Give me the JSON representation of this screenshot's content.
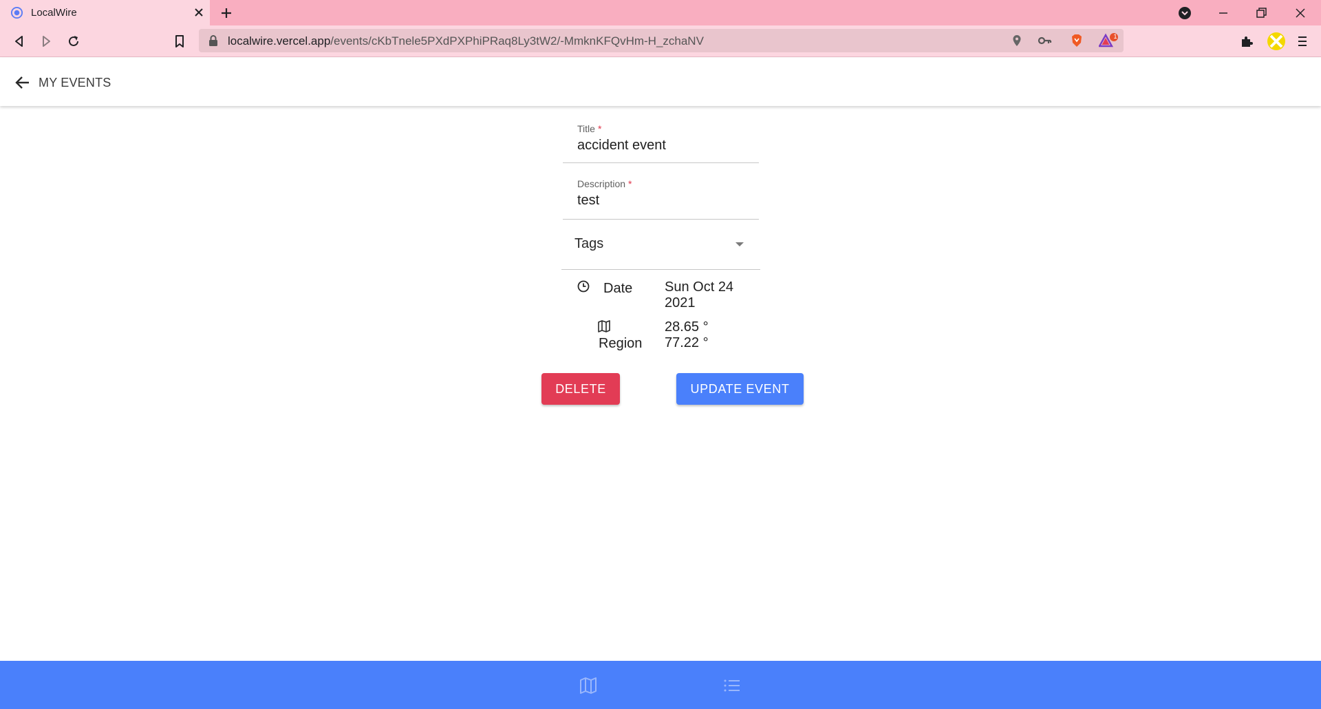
{
  "browser": {
    "tab_title": "LocalWire",
    "url_host": "localwire.vercel.app",
    "url_path": "/events/cKbTnele5PXdPXPhiPRaq8Ly3tW2/-MmknKFQvHm-H_zchaNV",
    "brave_badge_count": "1"
  },
  "appbar": {
    "back_label": "MY EVENTS"
  },
  "form": {
    "title_label": "Title",
    "title_value": "accident event",
    "description_label": "Description",
    "description_value": "test",
    "required_mark": "*",
    "tags_label": "Tags"
  },
  "info": {
    "date_label": "Date",
    "date_line1": "Sun Oct 24",
    "date_line2": "2021",
    "region_label": "Region",
    "lat": "28.65 °",
    "lng": "77.22 °"
  },
  "actions": {
    "delete_label": "DELETE",
    "update_label": "UPDATE EVENT"
  },
  "colors": {
    "tabbar": "#f9aec0",
    "toolbar": "#fcd6e0",
    "delete": "#e23c55",
    "primary": "#4a80fb"
  },
  "icons": {
    "bottom_nav": [
      "map-icon",
      "list-icon"
    ]
  }
}
